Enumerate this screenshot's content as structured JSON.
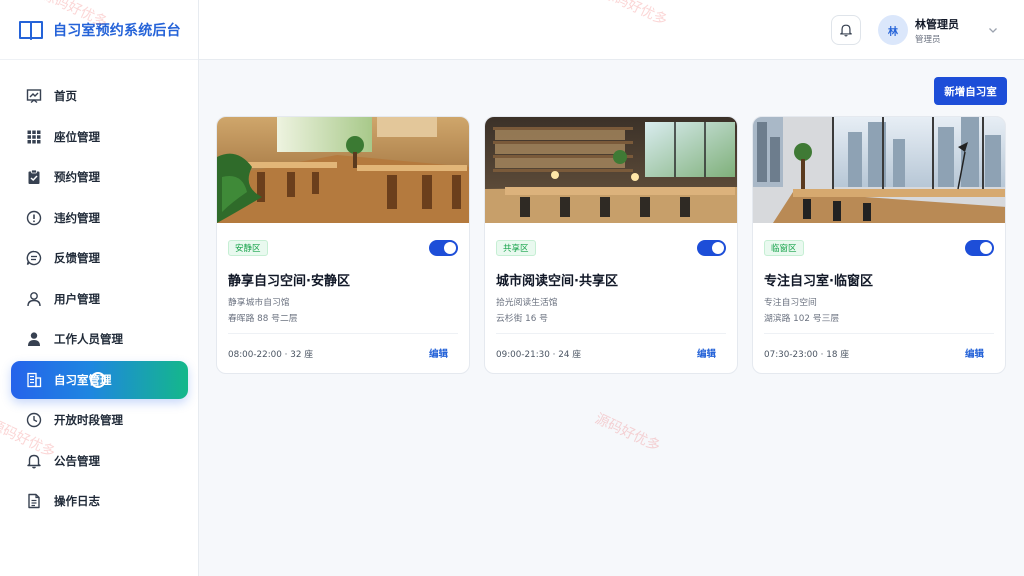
{
  "brand": {
    "title": "自习室预约系统后台"
  },
  "sidebar": {
    "items": [
      {
        "label": "首页",
        "icon": "chart-line-icon"
      },
      {
        "label": "座位管理",
        "icon": "grid-icon"
      },
      {
        "label": "预约管理",
        "icon": "clipboard-check-icon"
      },
      {
        "label": "违约管理",
        "icon": "alert-circle-icon"
      },
      {
        "label": "反馈管理",
        "icon": "message-circle-icon"
      },
      {
        "label": "用户管理",
        "icon": "user-icon"
      },
      {
        "label": "工作人员管理",
        "icon": "staff-icon"
      },
      {
        "label": "自习室管理",
        "icon": "building-icon"
      },
      {
        "label": "开放时段管理",
        "icon": "clock-icon"
      },
      {
        "label": "公告管理",
        "icon": "bell-icon"
      },
      {
        "label": "操作日志",
        "icon": "file-text-icon"
      }
    ],
    "active_index": 7
  },
  "header": {
    "avatar_text": "林",
    "user_name": "林管理员",
    "user_role": "管理员"
  },
  "toolbar": {
    "add_label": "新增自习室"
  },
  "cards": [
    {
      "tag": "安静区",
      "title": "静享自习空间·安静区",
      "subtitle": "静享城市自习馆",
      "address": "春晖路 88 号二层",
      "meta": "08:00-22:00 · 32 座",
      "edit_label": "编辑",
      "enabled": true
    },
    {
      "tag": "共享区",
      "title": "城市阅读空间·共享区",
      "subtitle": "拾光阅读生活馆",
      "address": "云杉街 16 号",
      "meta": "09:00-21:30 · 24 座",
      "edit_label": "编辑",
      "enabled": true
    },
    {
      "tag": "临窗区",
      "title": "专注自习室·临窗区",
      "subtitle": "专注自习空间",
      "address": "湖滨路 102 号三层",
      "meta": "07:30-23:00 · 18 座",
      "edit_label": "编辑",
      "enabled": true
    }
  ],
  "watermark": {
    "text": "源码好优多"
  },
  "colors": {
    "primary": "#1d4ed8",
    "accent_green": "#16a34a",
    "gradient_end": "#14b88a"
  }
}
